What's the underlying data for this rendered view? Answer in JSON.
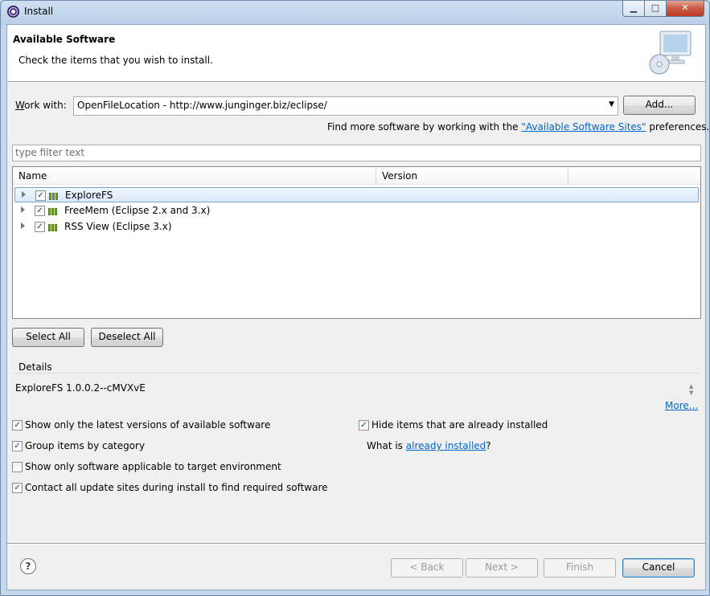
{
  "window": {
    "title": "Install",
    "controls": {
      "minimize": "▁",
      "maximize": "□",
      "close": "✕"
    }
  },
  "banner": {
    "title": "Available Software",
    "description": "Check the items that you wish to install.",
    "image": "computer-cd-icon"
  },
  "work_with": {
    "label_prefix": "W",
    "label_rest": "ork with:",
    "value": "OpenFileLocation - http://www.junginger.biz/eclipse/",
    "add_button": "Add...",
    "find_more_prefix": "Find more software by working with the ",
    "find_more_link": "\"Available Software Sites\"",
    "find_more_suffix": " preferences."
  },
  "filter": {
    "placeholder": "type filter text"
  },
  "tree": {
    "columns": [
      "Name",
      "Version"
    ],
    "rows": [
      {
        "name": "ExploreFS",
        "checked": true,
        "selected": true
      },
      {
        "name": "FreeMem (Eclipse 2.x and 3.x)",
        "checked": true,
        "selected": false
      },
      {
        "name": "RSS View (Eclipse 3.x)",
        "checked": true,
        "selected": false
      }
    ]
  },
  "selection_buttons": {
    "select_all": "Select All",
    "deselect_all": "Deselect All"
  },
  "details": {
    "label": "Details",
    "text": "ExploreFS 1.0.0.2--cMVXvE",
    "more_link": "More..."
  },
  "options": {
    "show_latest": {
      "label": "Show only the latest versions of available software",
      "checked": true
    },
    "group_by_category": {
      "label": "Group items by category",
      "checked": true
    },
    "show_applicable": {
      "label": "Show only software applicable to target environment",
      "checked": false
    },
    "contact_sites": {
      "label": "Contact all update sites during install to find required software",
      "checked": true
    },
    "hide_installed": {
      "label": "Hide items that are already installed",
      "checked": true
    },
    "what_is_prefix": "What is ",
    "already_installed_link": "already installed",
    "what_is_suffix": "?"
  },
  "footer": {
    "help_icon": "help-icon",
    "back": "< Back",
    "next": "Next >",
    "finish": "Finish",
    "cancel": "Cancel"
  }
}
